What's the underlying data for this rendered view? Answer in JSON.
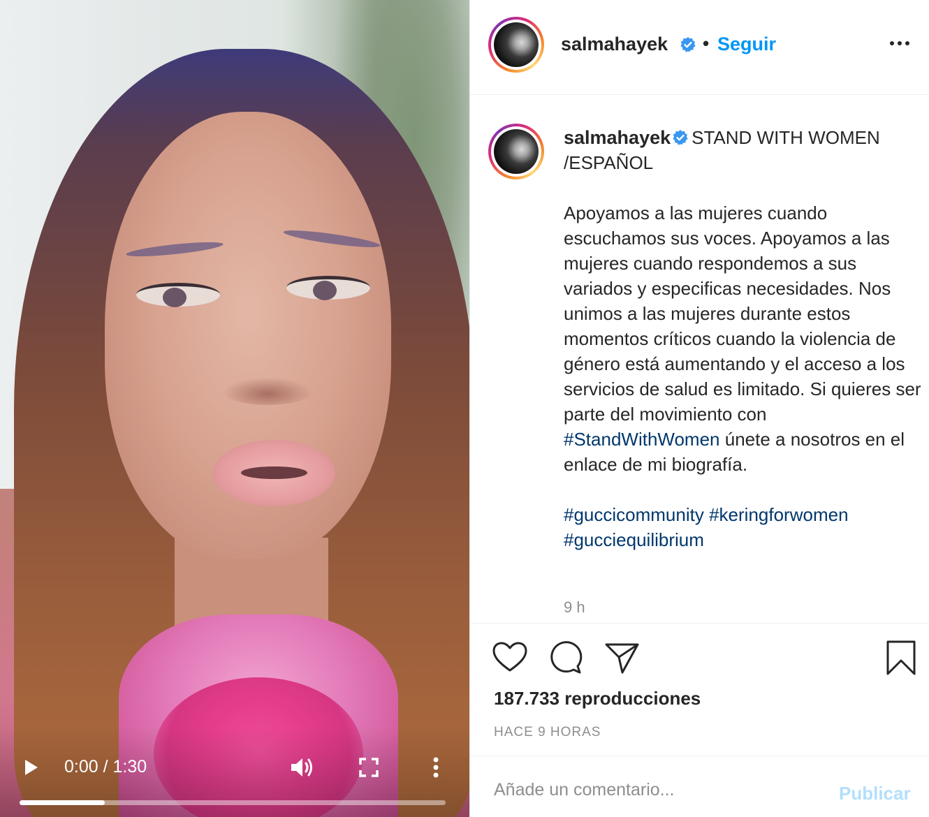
{
  "video": {
    "current_time": "0:00",
    "duration": "1:30",
    "time_display": "0:00 / 1:30",
    "progress_fraction": 0.2,
    "icons": [
      "play-icon",
      "volume-icon",
      "fullscreen-icon",
      "more-vertical-icon"
    ]
  },
  "header": {
    "username": "salmahayek",
    "separator": "•",
    "follow_label": "Seguir",
    "options_icon": "more-horizontal-icon"
  },
  "caption": {
    "username": "salmahayek",
    "title": "STAND WITH WOMEN /ESPAÑOL",
    "body_before_tag": "Apoyamos a las mujeres cuando escuchamos sus voces. Apoyamos a las mujeres cuando respondemos a sus variados y especificas necesidades. Nos unimos a las mujeres durante estos momentos críticos cuando la violencia de género está aumentando y el acceso a los servicios de salud es limitado. Si quieres ser parte del movimiento con",
    "inline_hashtag": "#StandWithWomen",
    "body_after_tag": "únete a nosotros en el enlace de mi biografía.",
    "hashtags": [
      "#guccicommunity",
      "#keringforwomen",
      "#gucciequilibrium"
    ],
    "time_ago": "9 h"
  },
  "actions": {
    "icons": [
      "heart-icon",
      "comment-icon",
      "share-icon",
      "bookmark-icon"
    ],
    "views": "187.733 reproducciones",
    "posted": "HACE 9 HORAS"
  },
  "comment_bar": {
    "placeholder": "Añade un comentario...",
    "publish_label": "Publicar"
  },
  "colors": {
    "link_blue": "#0095f6",
    "hashtag_navy": "#00376b",
    "verified_blue": "#3897f0",
    "muted_gray": "#8e8e8e",
    "publish_disabled": "#b2dffc"
  }
}
